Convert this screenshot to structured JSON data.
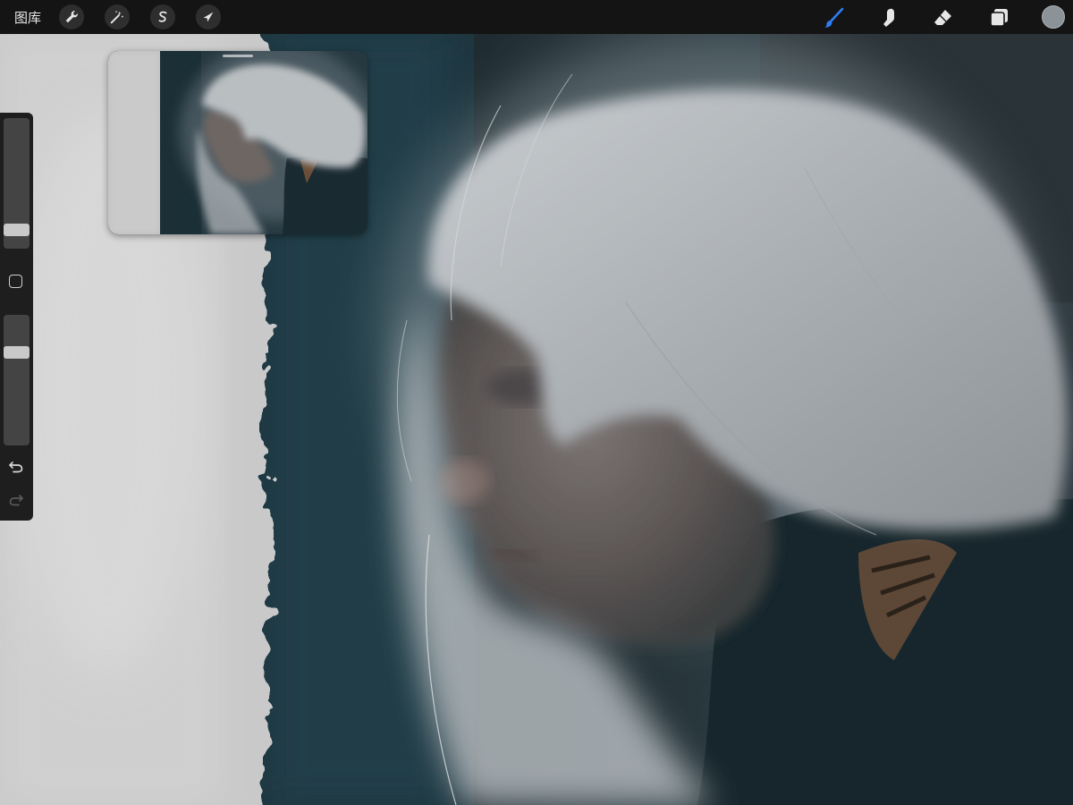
{
  "app": {
    "gallery_label": "图库"
  },
  "toolbar": {
    "left_tools": [
      {
        "name": "actions",
        "icon": "wrench-icon"
      },
      {
        "name": "adjustments",
        "icon": "magic-wand-icon"
      },
      {
        "name": "selection",
        "icon": "selection-s-icon"
      },
      {
        "name": "transform",
        "icon": "arrow-cursor-icon"
      }
    ],
    "right_tools": [
      {
        "name": "brush",
        "icon": "brush-icon",
        "active": true
      },
      {
        "name": "smudge",
        "icon": "smudge-finger-icon"
      },
      {
        "name": "eraser",
        "icon": "eraser-icon"
      },
      {
        "name": "layers",
        "icon": "layers-icon"
      }
    ],
    "current_color": "#8c9398",
    "active_color": "#2f7df6"
  },
  "sidebar": {
    "brush_size_level": 0.13,
    "opacity_level": 0.72,
    "buttons": [
      "modify-square-icon",
      "undo-icon",
      "redo-icon"
    ]
  },
  "reference_window": {
    "visible": true
  }
}
